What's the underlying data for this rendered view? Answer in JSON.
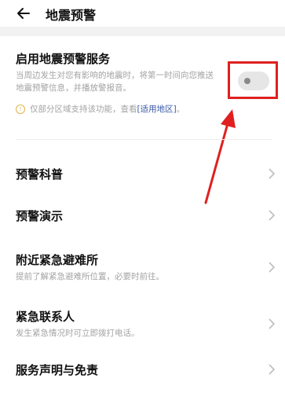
{
  "header": {
    "title": "地震预警"
  },
  "service": {
    "title": "启用地震预警服务",
    "description": "当周边发生对您有影响的地震时，将第一时间向您推送地震预警信息，并播放警报音。",
    "toggle_state": "off",
    "notice_prefix": "仅部分区域支持该功能，查看",
    "notice_link": "[适用地区]",
    "notice_suffix": "。"
  },
  "menu": [
    {
      "label": "预警科普",
      "sub": ""
    },
    {
      "label": "预警演示",
      "sub": ""
    },
    {
      "label": "附近紧急避难所",
      "sub": "提前了解紧急避难所位置，必要时前往。"
    },
    {
      "label": "紧急联系人",
      "sub": "发生紧急情况时可立即拨打电话。"
    },
    {
      "label": "服务声明与免责",
      "sub": ""
    }
  ],
  "colors": {
    "highlight": "#e02020",
    "link": "#3a59a8",
    "notice_icon": "#e0b64a"
  },
  "icons": [
    "back-arrow-icon",
    "info-icon",
    "chevron-right-icon"
  ]
}
